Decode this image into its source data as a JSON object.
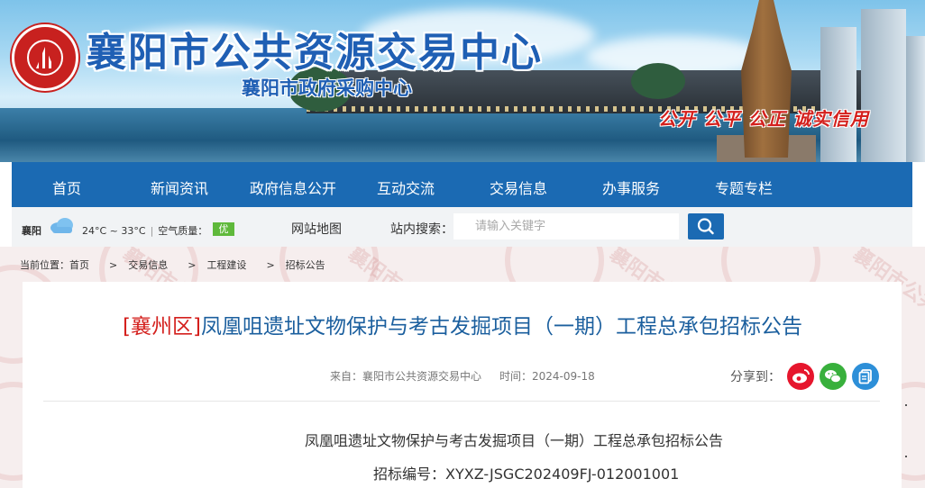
{
  "header": {
    "title": "襄阳市公共资源交易中心",
    "subtitle": "襄阳市政府采购中心",
    "slogan": "公开 公平 公正 诚实信用"
  },
  "nav": {
    "items": [
      "首页",
      "新闻资讯",
      "政府信息公开",
      "互动交流",
      "交易信息",
      "办事服务",
      "专题专栏"
    ]
  },
  "toolbar": {
    "city": "襄阳",
    "weather_icon": "cloud-icon",
    "temperature": "24°C ~ 33°C",
    "aqi_label": "空气质量：",
    "aqi_value": "优",
    "aqi_color": "#5fb93b",
    "sitemap": "网站地图",
    "search_label": "站内搜索：",
    "search_placeholder": "请输入关键字"
  },
  "breadcrumb": {
    "prefix": "当前位置：",
    "items": [
      "首页",
      "交易信息",
      "工程建设",
      "招标公告"
    ],
    "separator": ">"
  },
  "article": {
    "district": "[襄州区]",
    "title": "凤凰咀遗址文物保护与考古发掘项目（一期）工程总承包招标公告",
    "source": "来自：襄阳市公共资源交易中心",
    "time": "时间：2024-09-18",
    "share_label": "分享到：",
    "share_icons": [
      "weibo-icon",
      "wechat-icon",
      "copy-icon"
    ],
    "body_heading": "凤凰咀遗址文物保护与考古发掘项目（一期）工程总承包招标公告",
    "tender_no_label": "招标编号：",
    "tender_no": "XYXZ-JSGC202409FJ-012001001"
  },
  "colors": {
    "brand_blue": "#1b6ab3",
    "title_blue": "#1b5f9e",
    "accent_red": "#d4201d",
    "weibo_red": "#e6162d",
    "wechat_green": "#38b03c",
    "copy_blue": "#2d8fd8"
  }
}
